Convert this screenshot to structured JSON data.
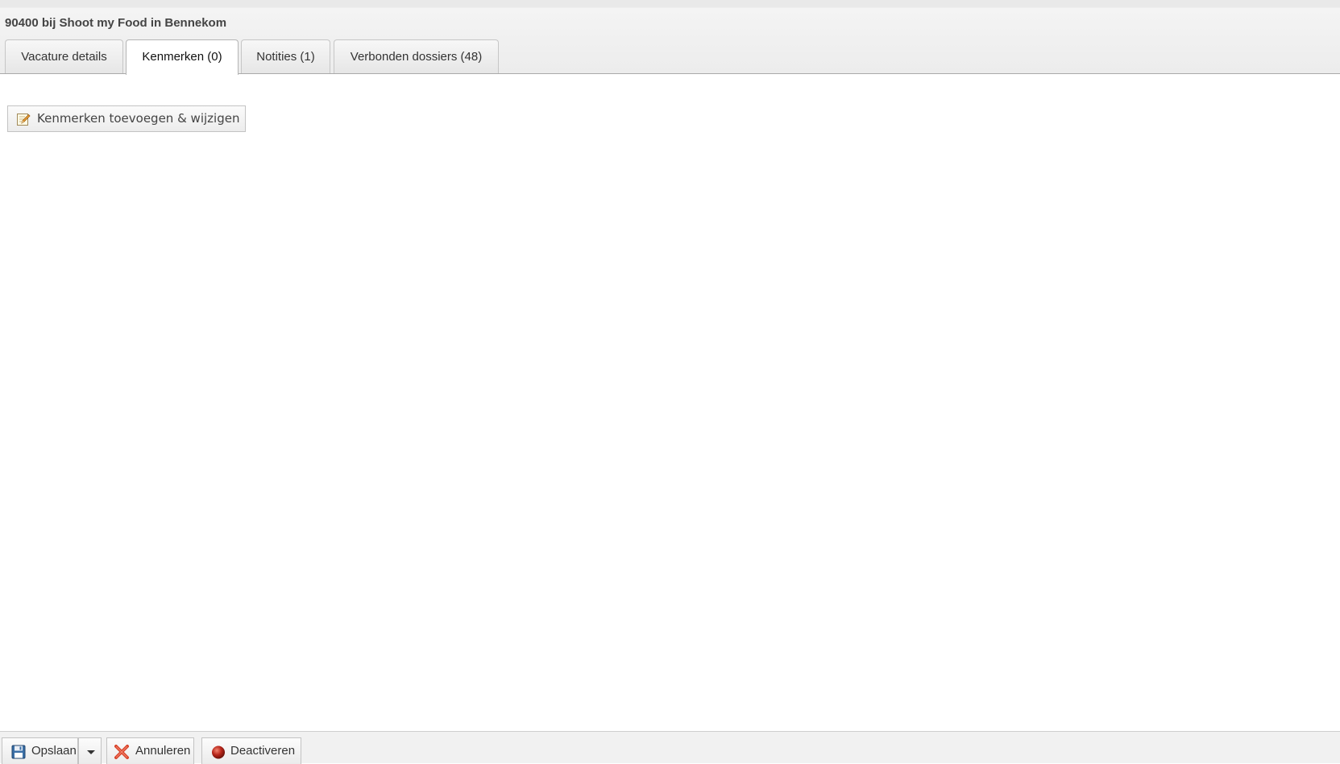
{
  "header": {
    "title": "90400 bij Shoot my Food in Bennekom",
    "tabs": [
      {
        "label": "Vacature details",
        "active": false
      },
      {
        "label": "Kenmerken (0)",
        "active": true
      },
      {
        "label": "Notities (1)",
        "active": false
      },
      {
        "label": "Verbonden dossiers (48)",
        "active": false
      }
    ]
  },
  "main": {
    "edit_button_label": "Kenmerken toevoegen & wijzigen",
    "edit_icon": "pencil-edit-icon"
  },
  "footer": {
    "save_label": "Opslaan",
    "save_icon": "floppy-disk-icon",
    "dropdown_icon": "chevron-down-icon",
    "cancel_label": "Annuleren",
    "cancel_icon": "red-x-icon",
    "deactivate_label": "Deactiveren",
    "deactivate_icon": "red-ball-icon"
  },
  "colors": {
    "header_bg": "#ececec",
    "cancel_red": "#d9442b",
    "deactivate_red": "#b8261b",
    "save_blue": "#3a6ea5"
  }
}
